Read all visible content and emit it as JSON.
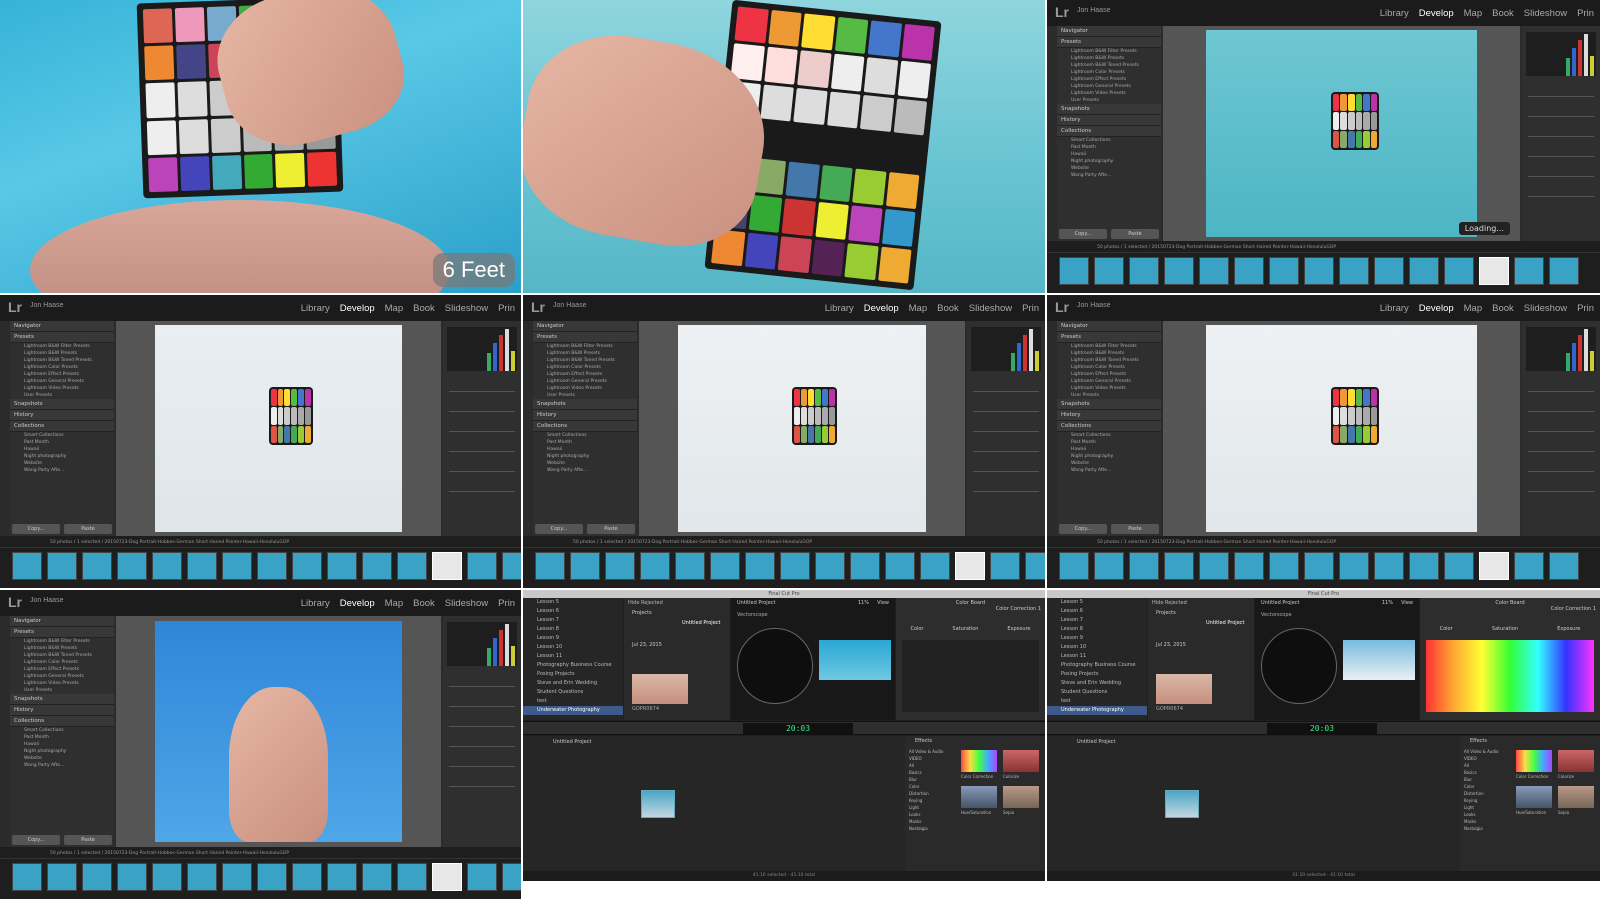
{
  "panel1": {
    "badge": "6 Feet"
  },
  "lightroom": {
    "logo": "Lr",
    "user": "Jon Haase",
    "modules": [
      "Library",
      "Develop",
      "Map",
      "Book",
      "Slideshow",
      "Prin"
    ],
    "left_panels": [
      "Navigator",
      "Presets",
      "Snapshots",
      "History",
      "Collections"
    ],
    "presets": [
      "Lightroom B&W Filter Presets",
      "Lightroom B&W Presets",
      "Lightroom B&W Toned Presets",
      "Lightroom Color Presets",
      "Lightroom Effect Presets",
      "Lightroom General Presets",
      "Lightroom Video Presets",
      "User Presets"
    ],
    "collections": [
      "Smart Collections",
      "Past Month",
      "Hawaii",
      "Night photography",
      "Website",
      "Wang Party Afte..."
    ],
    "copy": "Copy...",
    "paste": "Paste",
    "filmstrip_info": "50 photos / 1 selected / 20150723-Dog Portrait-Hobbes-German Short Haired Pointer-Hawaii-HonoluluGOP",
    "loading": "Loading..."
  },
  "fcp": {
    "title": "Final Cut Pro",
    "libraries": [
      "Lesson 5",
      "Lesson 6",
      "Lesson 7",
      "Lesson 8",
      "Lesson 9",
      "Lesson 10",
      "Lesson 11",
      "Photography Business Course",
      "Posing Projects",
      "Steve and Erin Wedding",
      "Student Questions",
      "test",
      "Underwater Photography"
    ],
    "browser_hide": "Hide Rejected",
    "project_label": "Projects",
    "project_name": "Untitled Project",
    "date_group": "Jul 23, 2015",
    "clip_name": "GOPR0674",
    "viewer_title": "Untitled Project",
    "zoom": "11%",
    "view": "View",
    "scope_name": "Vectorscope",
    "inspector_title": "Color Board",
    "inspector_sub": "Color Correction 1",
    "tabs": [
      "Color",
      "Saturation",
      "Exposure"
    ],
    "timecode": "20:03",
    "timeline_title": "Untitled Project",
    "effects_title": "Effects",
    "effects_cats": [
      "All Video & Audio",
      "VIDEO",
      "All",
      "Basics",
      "Blur",
      "Color",
      "Distortion",
      "Keying",
      "Light",
      "Looks",
      "Masks",
      "Nostalgia"
    ],
    "effects_items": [
      "Color Correction",
      "Colorize",
      "Hue/Saturation",
      "Sepia"
    ],
    "bottom": "41:10 selected - 41:10 total"
  }
}
